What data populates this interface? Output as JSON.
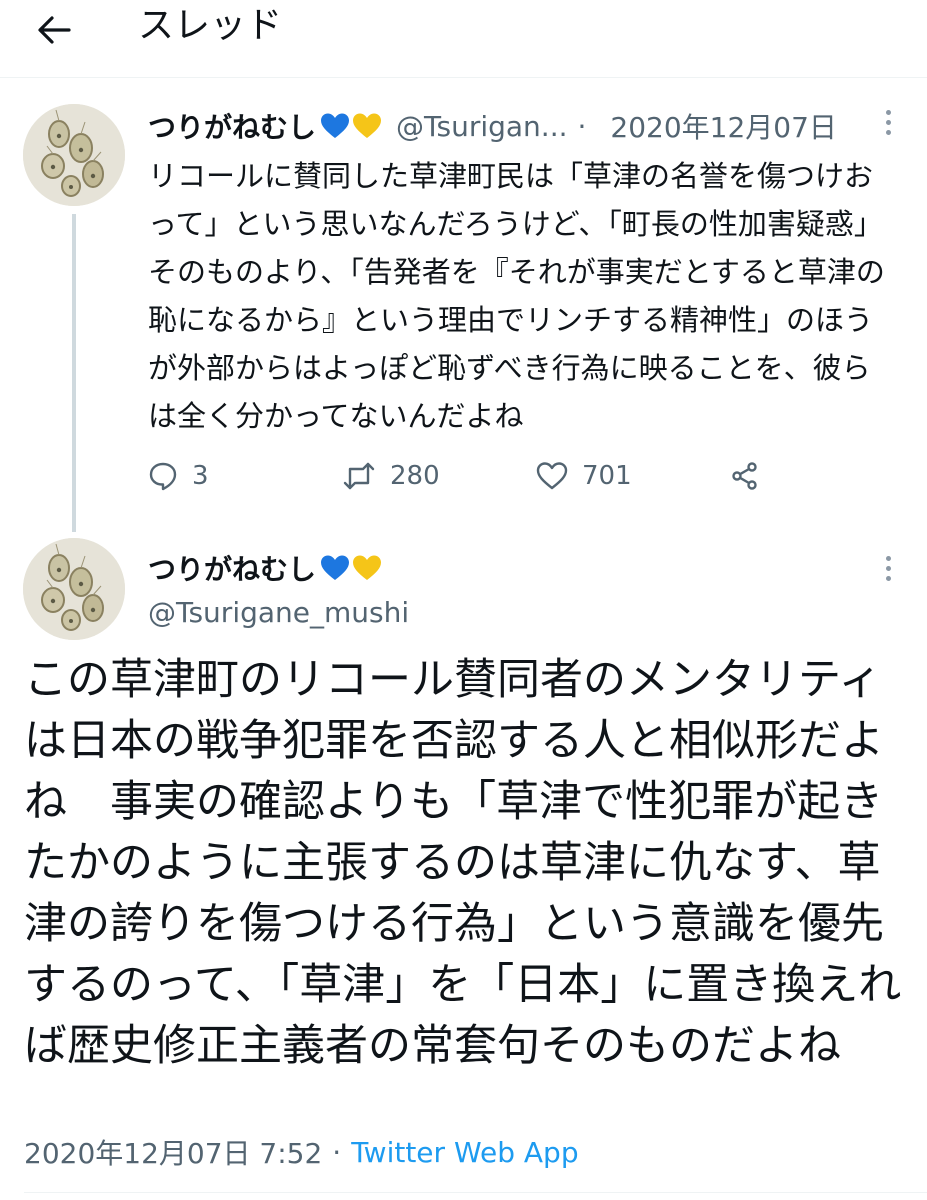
{
  "header": {
    "title": "スレッド",
    "back_icon": "arrow-left-icon"
  },
  "colors": {
    "link": "#1d9bf0",
    "secondary_text": "#536471",
    "heart_blue": "#1d77e0",
    "heart_yellow": "#f5c518"
  },
  "tweet1": {
    "display_name": "つりがねむし",
    "name_emoji": [
      "blue-heart-icon",
      "yellow-heart-icon"
    ],
    "handle": "@Tsurigan...",
    "date": "2020年12月07日",
    "text": "リコールに賛同した草津町民は「草津の名誉を傷つけおって」という思いなんだろうけど、「町長の性加害疑惑」そのものより、「告発者を『それが事実だとすると草津の恥になるから』という理由でリンチする精神性」のほうが外部からはよっぽど恥ずべき行為に映ることを、彼らは全く分かってないんだよね",
    "replies": "3",
    "retweets": "280",
    "likes": "701"
  },
  "tweet2": {
    "display_name": "つりがねむし",
    "name_emoji": [
      "blue-heart-icon",
      "yellow-heart-icon"
    ],
    "handle": "@Tsurigane_mushi",
    "text": "この草津町のリコール賛同者のメンタリティは日本の戦争犯罪を否認する人と相似形だよね　事実の確認よりも「草津で性犯罪が起きたかのように主張するのは草津に仇なす、草津の誇りを傷つける行為」という意識を優先するのって、「草津」を「日本」に置き換えれば歴史修正主義者の常套句そのものだよね",
    "timestamp": "2020年12月07日 7:52",
    "separator": "·",
    "app": "Twitter Web App"
  }
}
